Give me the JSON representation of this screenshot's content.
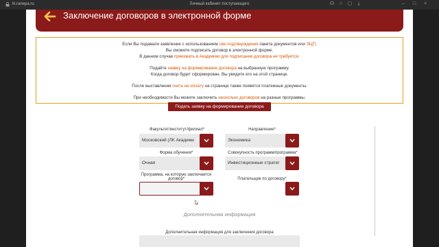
{
  "browser": {
    "url": "lk.ranepa.ru",
    "window_title": "Личный кабинет поступающего"
  },
  "header": {
    "title": "Заключение договоров в электронной форме"
  },
  "notice": {
    "p1_a": "Если Вы подавали заявление с использованием ",
    "p1_link1": "смс-подтверждения",
    "p1_b": " пакета документов или ",
    "p1_link2": "ЭЦП",
    "p1_c": ",",
    "p2": "Вы сможете подписать договор в электронной форме.",
    "p3_a": "В данном случае ",
    "p3_link": "приезжать в Академию для подписания договора не требуется",
    "p3_b": ".",
    "p4_a": "Подайте ",
    "p4_link": "заявку на формирование договора",
    "p4_b": " на выбранную программу.",
    "p5": "Когда договор будет сформирован, Вы увидите его на этой странице.",
    "p6_a": "После выставления ",
    "p6_link": "счета на оплату",
    "p6_b": " на странице также появятся платежные документы.",
    "p7_a": "При необходимости Вы можете заключить ",
    "p7_link": "несколько договоров",
    "p7_b": " на разные программы."
  },
  "cta_label": "Подать заявку на формирование договора",
  "form": {
    "faculty_label": "Факультет/институт/филиал*",
    "faculty_value": "Московский (ЛК Академи",
    "direction_label": "Направление*",
    "direction_value": "Экономика",
    "study_form_label": "Форма обучения*",
    "study_form_value": "Очная",
    "programs_label": "Совокупность программ/программа*",
    "programs_value": "Инвестиционные стратег",
    "program_label_1": "Программа, на которую заключается",
    "program_label_2": "договор*",
    "program_value": "",
    "payer_label": "Плательщик по договору*",
    "payer_value": ""
  },
  "additional": {
    "section_title": "Дополнительная информация",
    "field_label": "Дополнительная информация для заключения договора"
  },
  "colors": {
    "brand": "#8b1a1a",
    "link": "#d35400",
    "notice_border": "#e0a020"
  }
}
